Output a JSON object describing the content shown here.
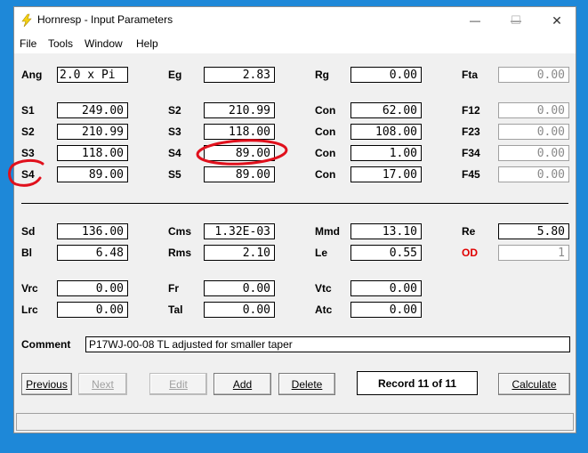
{
  "window": {
    "title": "Hornresp - Input Parameters",
    "minimize_glyph": "—",
    "maximize_glyph": "☐",
    "close_glyph": "✕"
  },
  "menu": [
    "File",
    "Tools",
    "Window",
    "Help"
  ],
  "params": {
    "ang": {
      "label": "Ang",
      "value": "2.0 x Pi"
    },
    "eg": {
      "label": "Eg",
      "value": "2.83"
    },
    "rg": {
      "label": "Rg",
      "value": "0.00"
    },
    "fta": {
      "label": "Fta",
      "value": "0.00"
    },
    "s1": {
      "label": "S1",
      "value": "249.00"
    },
    "s2a": {
      "label": "S2",
      "value": "210.99"
    },
    "con1": {
      "label": "Con",
      "value": "62.00"
    },
    "f12": {
      "label": "F12",
      "value": "0.00"
    },
    "s2b": {
      "label": "S2",
      "value": "210.99"
    },
    "s3a": {
      "label": "S3",
      "value": "118.00"
    },
    "con2": {
      "label": "Con",
      "value": "108.00"
    },
    "f23": {
      "label": "F23",
      "value": "0.00"
    },
    "s3b": {
      "label": "S3",
      "value": "118.00"
    },
    "s4a": {
      "label": "S4",
      "value": "89.00"
    },
    "con3": {
      "label": "Con",
      "value": "1.00"
    },
    "f34": {
      "label": "F34",
      "value": "0.00"
    },
    "s4b": {
      "label": "S4",
      "value": "89.00"
    },
    "s5": {
      "label": "S5",
      "value": "89.00"
    },
    "con4": {
      "label": "Con",
      "value": "17.00"
    },
    "f45": {
      "label": "F45",
      "value": "0.00"
    },
    "sd": {
      "label": "Sd",
      "value": "136.00"
    },
    "cms": {
      "label": "Cms",
      "value": "1.32E-03"
    },
    "mmd": {
      "label": "Mmd",
      "value": "13.10"
    },
    "re": {
      "label": "Re",
      "value": "5.80"
    },
    "bl": {
      "label": "Bl",
      "value": "6.48"
    },
    "rms": {
      "label": "Rms",
      "value": "2.10"
    },
    "le": {
      "label": "Le",
      "value": "0.55"
    },
    "od": {
      "label": "OD",
      "value": "1"
    },
    "vrc": {
      "label": "Vrc",
      "value": "0.00"
    },
    "fr": {
      "label": "Fr",
      "value": "0.00"
    },
    "vtc": {
      "label": "Vtc",
      "value": "0.00"
    },
    "lrc": {
      "label": "Lrc",
      "value": "0.00"
    },
    "tal": {
      "label": "Tal",
      "value": "0.00"
    },
    "atc": {
      "label": "Atc",
      "value": "0.00"
    }
  },
  "comment": {
    "label": "Comment",
    "value": "P17WJ-00-08 TL adjusted for smaller taper"
  },
  "buttons": {
    "previous": "Previous",
    "next": "Next",
    "edit": "Edit",
    "add": "Add",
    "delete": "Delete",
    "calculate": "Calculate"
  },
  "record": "Record 11 of 11",
  "colors": {
    "annotation": "#e0101c",
    "od_label": "#e00000",
    "desktop": "#1e88d8"
  }
}
